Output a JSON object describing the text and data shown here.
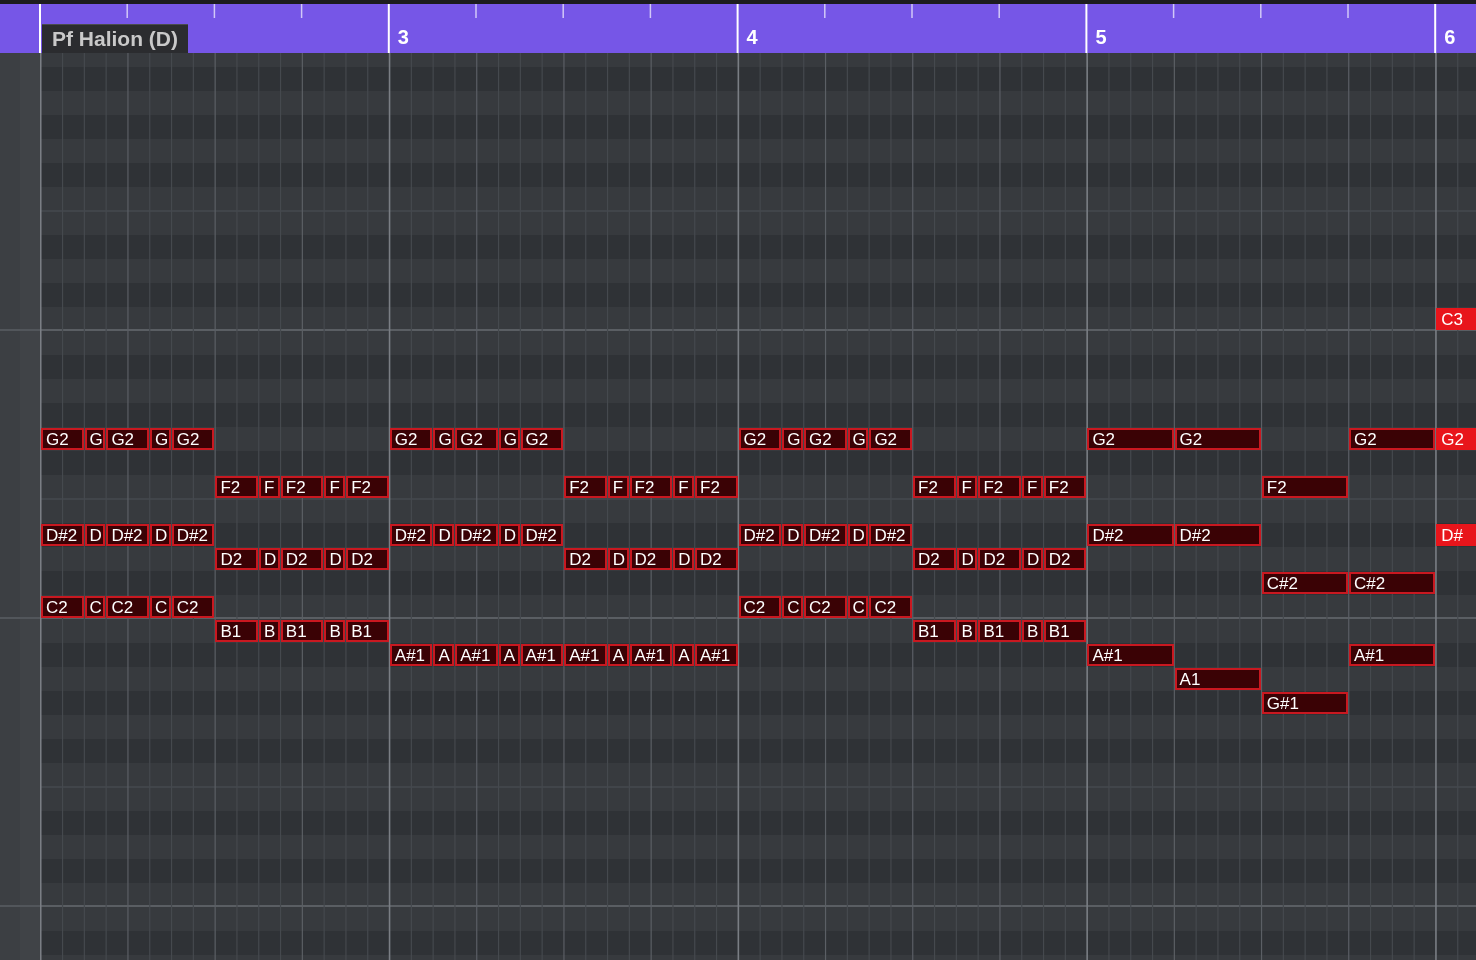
{
  "ruler": {
    "track_label": "Pf Halion (D)",
    "bars": [
      "3",
      "4",
      "5",
      "6"
    ]
  },
  "notes": [
    {
      "label": "C3",
      "selected": true
    },
    {
      "label": "G2",
      "selected": false
    },
    {
      "label": "G",
      "selected": false
    },
    {
      "label": "G2",
      "selected": false
    },
    {
      "label": "G",
      "selected": false
    },
    {
      "label": "G2",
      "selected": false
    },
    {
      "label": "G2",
      "selected": false
    },
    {
      "label": "G",
      "selected": false
    },
    {
      "label": "G2",
      "selected": false
    },
    {
      "label": "G",
      "selected": false
    },
    {
      "label": "G2",
      "selected": false
    },
    {
      "label": "G2",
      "selected": false
    },
    {
      "label": "G",
      "selected": false
    },
    {
      "label": "G2",
      "selected": false
    },
    {
      "label": "G",
      "selected": false
    },
    {
      "label": "G2",
      "selected": false
    },
    {
      "label": "G2",
      "selected": false
    },
    {
      "label": "G2",
      "selected": false
    },
    {
      "label": "G2",
      "selected": false
    },
    {
      "label": "G2",
      "selected": true
    },
    {
      "label": "F2",
      "selected": false
    },
    {
      "label": "F",
      "selected": false
    },
    {
      "label": "F2",
      "selected": false
    },
    {
      "label": "F",
      "selected": false
    },
    {
      "label": "F2",
      "selected": false
    },
    {
      "label": "F2",
      "selected": false
    },
    {
      "label": "F",
      "selected": false
    },
    {
      "label": "F2",
      "selected": false
    },
    {
      "label": "F",
      "selected": false
    },
    {
      "label": "F2",
      "selected": false
    },
    {
      "label": "F2",
      "selected": false
    },
    {
      "label": "F",
      "selected": false
    },
    {
      "label": "F2",
      "selected": false
    },
    {
      "label": "F",
      "selected": false
    },
    {
      "label": "F2",
      "selected": false
    },
    {
      "label": "F2",
      "selected": false
    },
    {
      "label": "D#2",
      "selected": false
    },
    {
      "label": "D",
      "selected": false
    },
    {
      "label": "D#2",
      "selected": false
    },
    {
      "label": "D",
      "selected": false
    },
    {
      "label": "D#2",
      "selected": false
    },
    {
      "label": "D#2",
      "selected": false
    },
    {
      "label": "D",
      "selected": false
    },
    {
      "label": "D#2",
      "selected": false
    },
    {
      "label": "D",
      "selected": false
    },
    {
      "label": "D#2",
      "selected": false
    },
    {
      "label": "D#2",
      "selected": false
    },
    {
      "label": "D",
      "selected": false
    },
    {
      "label": "D#2",
      "selected": false
    },
    {
      "label": "D",
      "selected": false
    },
    {
      "label": "D#2",
      "selected": false
    },
    {
      "label": "D#2",
      "selected": false
    },
    {
      "label": "D#2",
      "selected": false
    },
    {
      "label": "D#",
      "selected": true
    },
    {
      "label": "D2",
      "selected": false
    },
    {
      "label": "D",
      "selected": false
    },
    {
      "label": "D2",
      "selected": false
    },
    {
      "label": "D",
      "selected": false
    },
    {
      "label": "D2",
      "selected": false
    },
    {
      "label": "D2",
      "selected": false
    },
    {
      "label": "D",
      "selected": false
    },
    {
      "label": "D2",
      "selected": false
    },
    {
      "label": "D",
      "selected": false
    },
    {
      "label": "D2",
      "selected": false
    },
    {
      "label": "D2",
      "selected": false
    },
    {
      "label": "D",
      "selected": false
    },
    {
      "label": "D2",
      "selected": false
    },
    {
      "label": "D",
      "selected": false
    },
    {
      "label": "D2",
      "selected": false
    },
    {
      "label": "C#2",
      "selected": false
    },
    {
      "label": "C#2",
      "selected": false
    },
    {
      "label": "C2",
      "selected": false
    },
    {
      "label": "C",
      "selected": false
    },
    {
      "label": "C2",
      "selected": false
    },
    {
      "label": "C",
      "selected": false
    },
    {
      "label": "C2",
      "selected": false
    },
    {
      "label": "C2",
      "selected": false
    },
    {
      "label": "C",
      "selected": false
    },
    {
      "label": "C2",
      "selected": false
    },
    {
      "label": "C",
      "selected": false
    },
    {
      "label": "C2",
      "selected": false
    },
    {
      "label": "B1",
      "selected": false
    },
    {
      "label": "B",
      "selected": false
    },
    {
      "label": "B1",
      "selected": false
    },
    {
      "label": "B",
      "selected": false
    },
    {
      "label": "B1",
      "selected": false
    },
    {
      "label": "B1",
      "selected": false
    },
    {
      "label": "B",
      "selected": false
    },
    {
      "label": "B1",
      "selected": false
    },
    {
      "label": "B",
      "selected": false
    },
    {
      "label": "B1",
      "selected": false
    },
    {
      "label": "A#1",
      "selected": false
    },
    {
      "label": "A",
      "selected": false
    },
    {
      "label": "A#1",
      "selected": false
    },
    {
      "label": "A",
      "selected": false
    },
    {
      "label": "A#1",
      "selected": false
    },
    {
      "label": "A#1",
      "selected": false
    },
    {
      "label": "A",
      "selected": false
    },
    {
      "label": "A#1",
      "selected": false
    },
    {
      "label": "A",
      "selected": false
    },
    {
      "label": "A#1",
      "selected": false
    },
    {
      "label": "A#1",
      "selected": false
    },
    {
      "label": "A#1",
      "selected": false
    },
    {
      "label": "A1",
      "selected": false
    },
    {
      "label": "G#1",
      "selected": false
    }
  ]
}
